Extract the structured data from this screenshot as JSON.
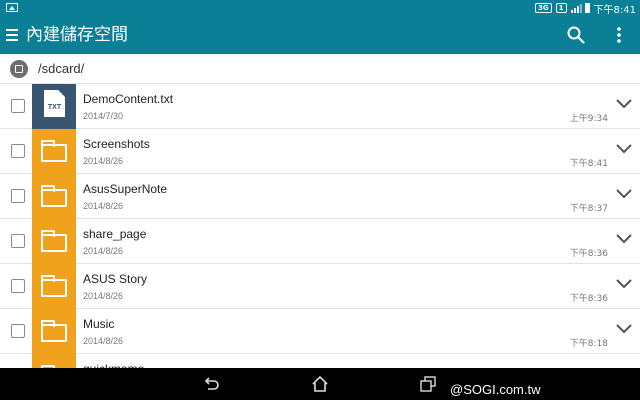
{
  "status_bar": {
    "network_label": "3G",
    "sim_label": "1",
    "time": "下午8:41"
  },
  "app_bar": {
    "title": "內建儲存空間"
  },
  "path_bar": {
    "path": "/sdcard/"
  },
  "files": [
    {
      "name": "DemoContent.txt",
      "date": "2014/7/30",
      "time": "上午9:34",
      "type": "txt",
      "type_label": "TXT"
    },
    {
      "name": "Screenshots",
      "date": "2014/8/26",
      "time": "下午8:41",
      "type": "folder"
    },
    {
      "name": "AsusSuperNote",
      "date": "2014/8/26",
      "time": "下午8:37",
      "type": "folder"
    },
    {
      "name": "share_page",
      "date": "2014/8/26",
      "time": "下午8:36",
      "type": "folder"
    },
    {
      "name": "ASUS Story",
      "date": "2014/8/26",
      "time": "下午8:36",
      "type": "folder"
    },
    {
      "name": "Music",
      "date": "2014/8/26",
      "time": "下午8:18",
      "type": "folder"
    },
    {
      "name": "quickmemo",
      "date": "",
      "time": "",
      "type": "folder"
    }
  ],
  "nav_bar": {
    "watermark": "@SOGI.com.tw"
  },
  "colors": {
    "app_bar": "#0b7f96",
    "folder": "#f0a21c",
    "txt_file": "#38566f"
  }
}
